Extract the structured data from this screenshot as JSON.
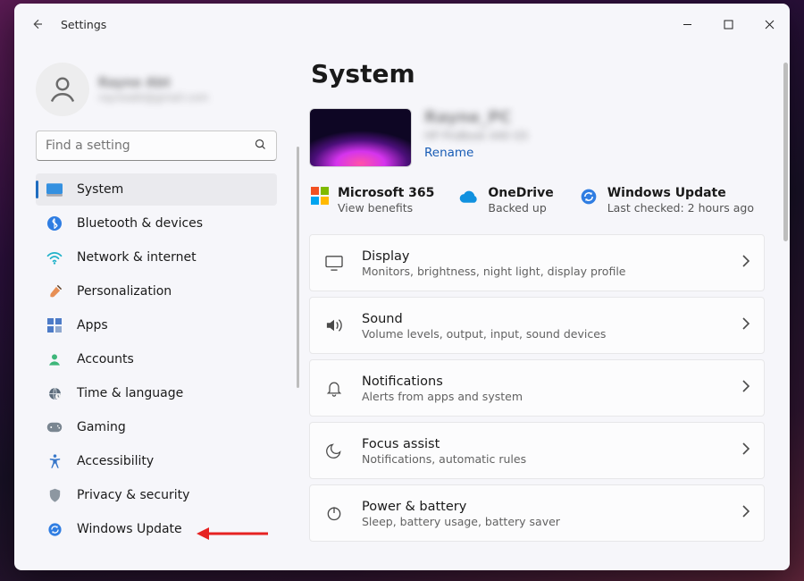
{
  "window": {
    "app_name": "Settings"
  },
  "account": {
    "display_name": "Rayne Abt",
    "email": "rayneabt@gmail.com"
  },
  "search": {
    "placeholder": "Find a setting"
  },
  "sidebar": {
    "items": [
      {
        "label": "System",
        "icon": "system-icon",
        "active": true
      },
      {
        "label": "Bluetooth & devices",
        "icon": "bluetooth-icon"
      },
      {
        "label": "Network & internet",
        "icon": "wifi-icon"
      },
      {
        "label": "Personalization",
        "icon": "brush-icon"
      },
      {
        "label": "Apps",
        "icon": "apps-icon"
      },
      {
        "label": "Accounts",
        "icon": "person-icon"
      },
      {
        "label": "Time & language",
        "icon": "globe-icon"
      },
      {
        "label": "Gaming",
        "icon": "game-icon"
      },
      {
        "label": "Accessibility",
        "icon": "accessibility-icon"
      },
      {
        "label": "Privacy & security",
        "icon": "shield-icon"
      },
      {
        "label": "Windows Update",
        "icon": "update-icon"
      }
    ]
  },
  "main": {
    "title": "System",
    "hero": {
      "pc_name": "Rayne_PC",
      "pc_model": "HP ProBook 440 G5",
      "rename_label": "Rename"
    },
    "status": [
      {
        "title": "Microsoft 365",
        "sub": "View benefits"
      },
      {
        "title": "OneDrive",
        "sub": "Backed up"
      },
      {
        "title": "Windows Update",
        "sub": "Last checked: 2 hours ago"
      }
    ],
    "cards": [
      {
        "title": "Display",
        "sub": "Monitors, brightness, night light, display profile",
        "icon": "display-icon"
      },
      {
        "title": "Sound",
        "sub": "Volume levels, output, input, sound devices",
        "icon": "sound-icon"
      },
      {
        "title": "Notifications",
        "sub": "Alerts from apps and system",
        "icon": "bell-icon"
      },
      {
        "title": "Focus assist",
        "sub": "Notifications, automatic rules",
        "icon": "moon-icon"
      },
      {
        "title": "Power & battery",
        "sub": "Sleep, battery usage, battery saver",
        "icon": "power-icon"
      }
    ]
  }
}
